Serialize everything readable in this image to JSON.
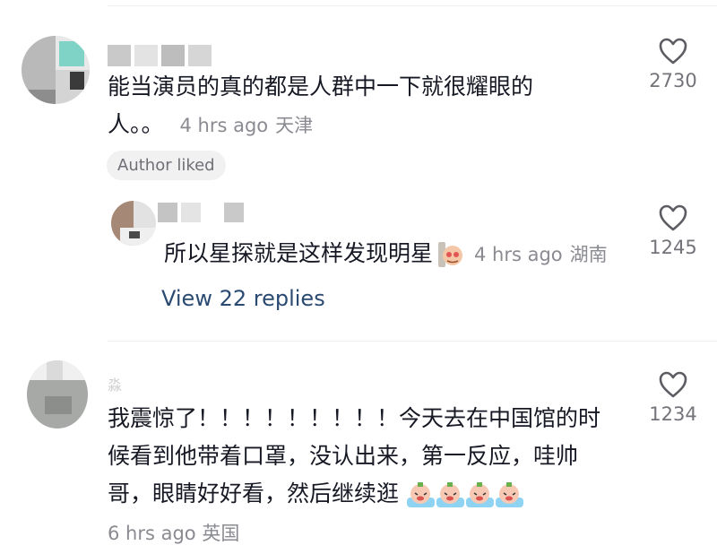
{
  "comments": [
    {
      "text_line1": "能当演员的真的都是人群中一下就很耀眼的",
      "text_line2": "人。。",
      "time": "4 hrs ago",
      "location": "天津",
      "likes": "2730",
      "badge": "Author liked"
    },
    {
      "text": "所以星探就是这样发现明星",
      "time": "4 hrs ago",
      "location": "湖南",
      "likes": "1245",
      "view_replies": "View 22 replies"
    },
    {
      "username": "淼",
      "text_line1": "我震惊了！！！！！！！！！今天去在中国馆的时",
      "text_line2": "候看到他带着口罩，没认出来，第一反应，哇帅",
      "text_line3": "哥，眼睛好好看，然后继续逛",
      "time": "6 hrs ago",
      "location": "英国",
      "likes": "1234"
    }
  ]
}
